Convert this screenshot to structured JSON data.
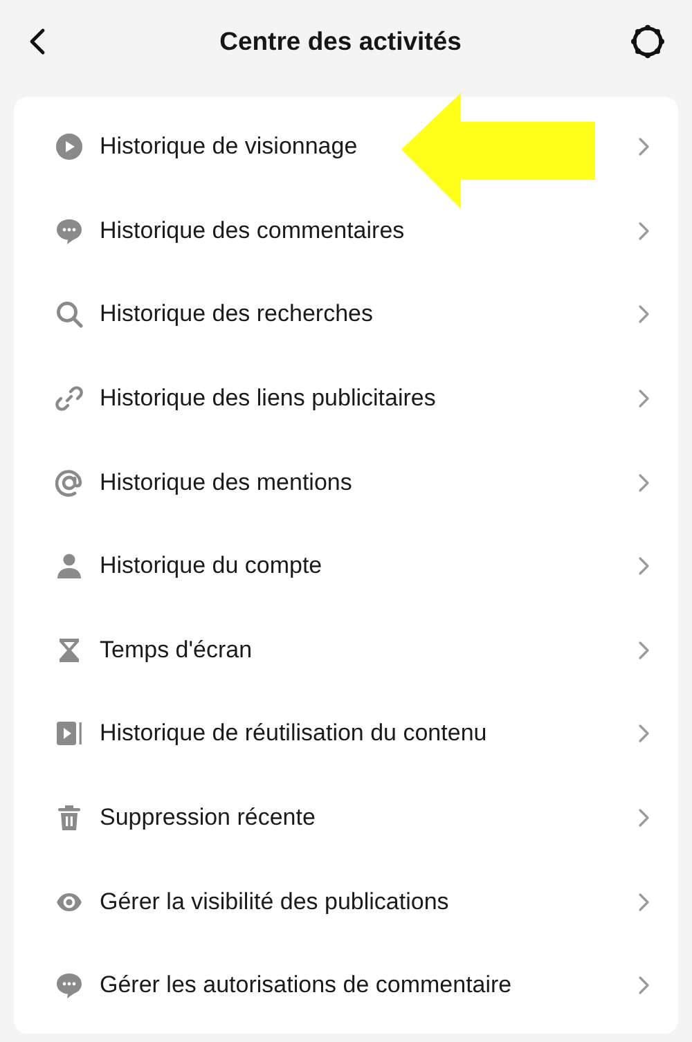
{
  "header": {
    "title": "Centre des activités"
  },
  "items": [
    {
      "label": "Historique de visionnage",
      "kind": "play"
    },
    {
      "label": "Historique des commentaires",
      "kind": "comment"
    },
    {
      "label": "Historique des recherches",
      "kind": "search"
    },
    {
      "label": "Historique des liens publicitaires",
      "kind": "link"
    },
    {
      "label": "Historique des mentions",
      "kind": "at"
    },
    {
      "label": "Historique du compte",
      "kind": "person"
    },
    {
      "label": "Temps d'écran",
      "kind": "hourglass"
    },
    {
      "label": "Historique de réutilisation du contenu",
      "kind": "reuse"
    },
    {
      "label": "Suppression récente",
      "kind": "trash"
    },
    {
      "label": "Gérer la visibilité des publications",
      "kind": "eye"
    },
    {
      "label": "Gérer les autorisations de commentaire",
      "kind": "comment"
    }
  ]
}
